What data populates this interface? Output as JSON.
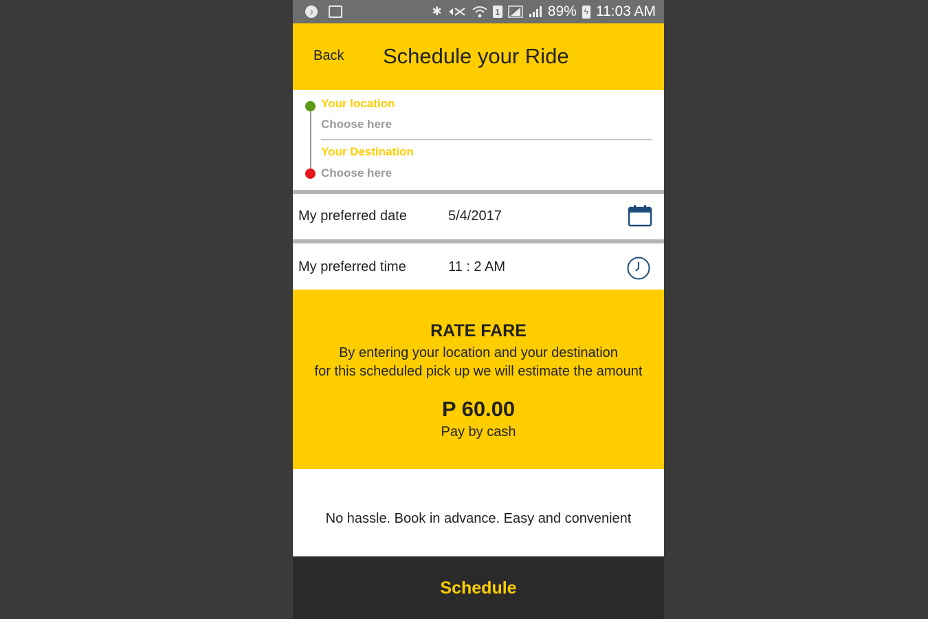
{
  "status_bar": {
    "battery": "89%",
    "time": "11:03 AM",
    "sim_slot": "1",
    "icons": [
      "music-icon",
      "image-icon",
      "bluetooth-icon",
      "mute-icon",
      "wifi-icon",
      "sim-icon",
      "signal-icon",
      "signal-icon",
      "battery-charging-icon"
    ]
  },
  "header": {
    "back_label": "Back",
    "title": "Schedule your Ride",
    "background": "#fecd00"
  },
  "route": {
    "origin_label": "Your location",
    "origin_value": "Choose here",
    "destination_label": "Your Destination",
    "destination_value": "Choose here",
    "origin_color": "#5a9a16",
    "destination_color": "#e8141c"
  },
  "date_row": {
    "label": "My preferred date",
    "value": "5/4/2017",
    "icon": "calendar-icon"
  },
  "time_row": {
    "label": "My preferred time",
    "value": "11 : 2 AM",
    "icon": "clock-icon"
  },
  "fare": {
    "title": "RATE FARE",
    "description_line1": "By entering your location and your destination",
    "description_line2": "for this scheduled pick up we will estimate the amount",
    "amount": "P 60.00",
    "payment": "Pay by cash"
  },
  "tagline": "No hassle. Book in advance. Easy and convenient",
  "schedule_button": {
    "label": "Schedule",
    "color": "#fecd00",
    "background": "#2b2a2a"
  },
  "accent_icon_color": "#1e4d7b"
}
